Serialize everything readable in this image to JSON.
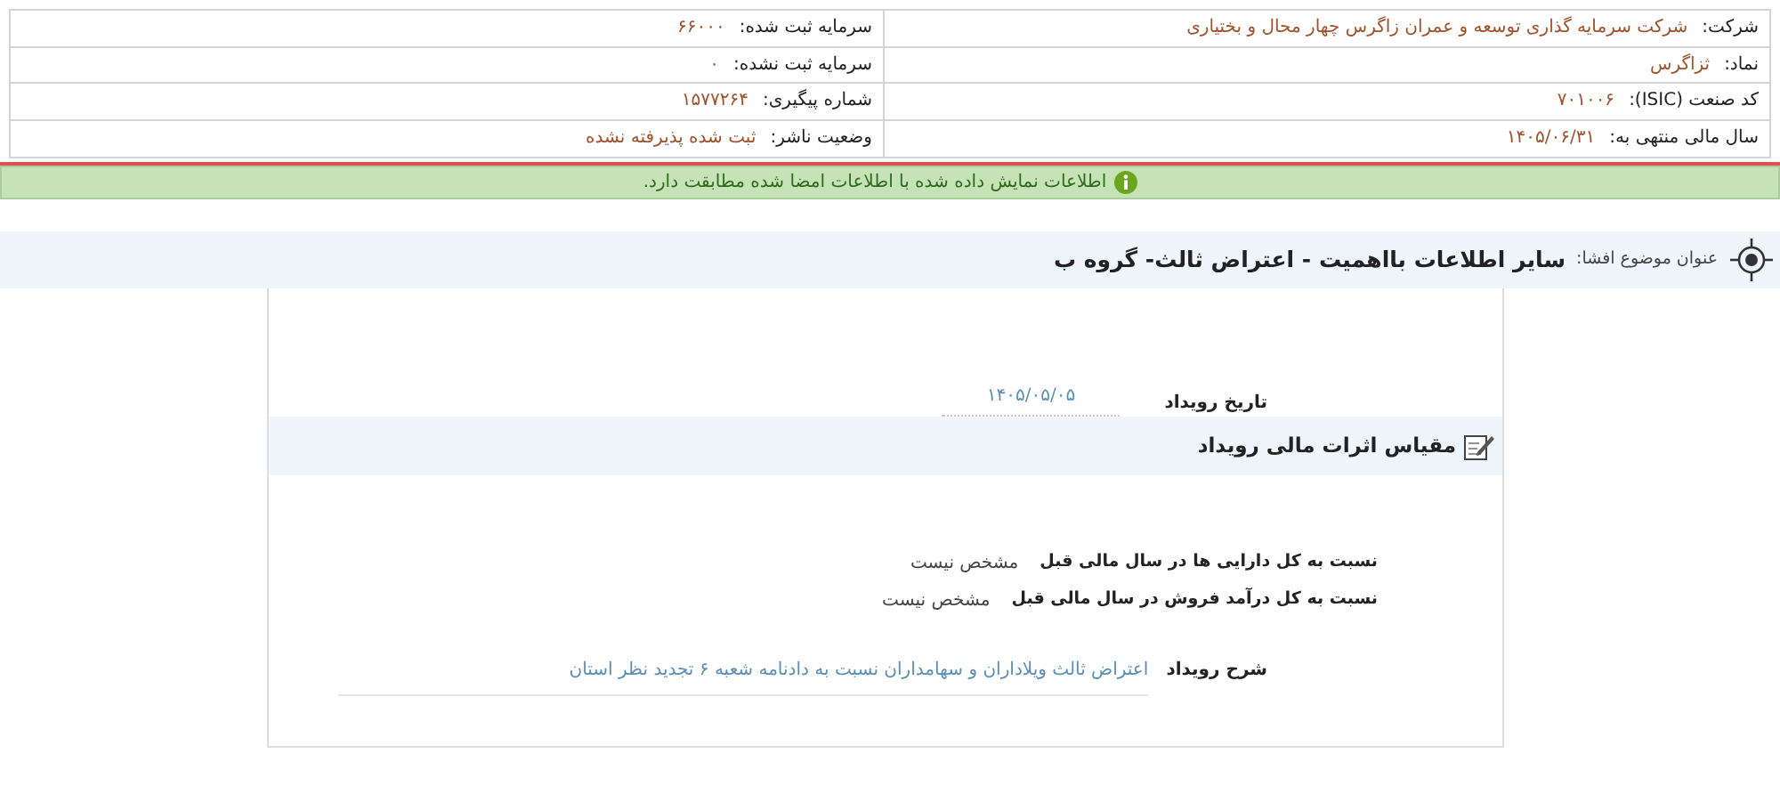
{
  "company_info": {
    "right": [
      {
        "label": "شرکت:",
        "value": "شرکت سرمایه گذاری توسعه و عمران زاگرس چهار محال و بختیاری"
      },
      {
        "label": "نماد:",
        "value": "ثزاگرس"
      },
      {
        "label": "کد صنعت (ISIC):",
        "value": "۷۰۱۰۰۶"
      },
      {
        "label": "سال مالی منتهی به:",
        "value": "۱۴۰۵/۰۶/۳۱"
      }
    ],
    "left": [
      {
        "label": "سرمایه ثبت شده:",
        "value": "۶۶۰۰۰"
      },
      {
        "label": "سرمایه ثبت نشده:",
        "value": "۰"
      },
      {
        "label": "شماره پیگیری:",
        "value": "۱۵۷۷۲۶۴"
      },
      {
        "label": "وضعیت ناشر:",
        "value": "ثبت شده پذیرفته نشده"
      }
    ]
  },
  "notice": {
    "text": "اطلاعات نمایش داده شده با اطلاعات امضا شده مطابقت دارد."
  },
  "subject": {
    "label": "عنوان موضوع افشا:",
    "title": "سایر اطلاعات بااهمیت - اعتراض ثالث- گروه ب"
  },
  "event_date": {
    "label": "تاریخ رویداد",
    "value": "۱۴۰۵/۰۵/۰۵"
  },
  "section": {
    "title": "مقیاس اثرات مالی رویداد"
  },
  "ratios": [
    {
      "label": "نسبت به کل دارایی ها در سال مالی قبل",
      "value": "مشخص نیست"
    },
    {
      "label": "نسبت به کل درآمد فروش در سال مالی قبل",
      "value": "مشخص نیست"
    }
  ],
  "description": {
    "label": "شرح رویداد",
    "value": "اعتراض ثالث ویلاداران و سهامداران نسبت به دادنامه شعبه ۶ تجدید نظر استان"
  }
}
